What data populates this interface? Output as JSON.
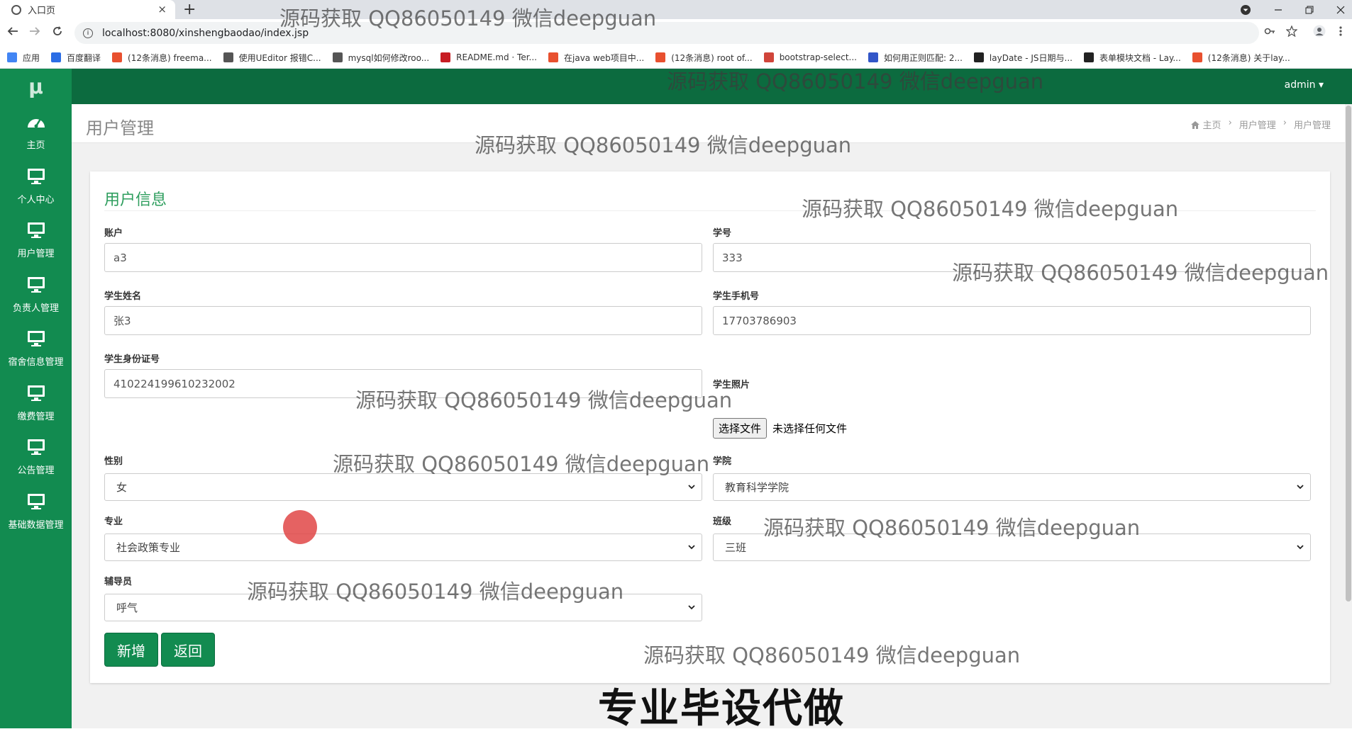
{
  "browser": {
    "tab_title": "入口页",
    "tab_close": "×",
    "new_tab": "+",
    "url": "localhost:8080/xinshengbaodao/index.jsp",
    "bookmarks": [
      {
        "label": "应用",
        "color": "#4285f4"
      },
      {
        "label": "百度翻译",
        "color": "#2b6de5"
      },
      {
        "label": "(12条消息) freema...",
        "color": "#e8502f"
      },
      {
        "label": "使用UEditor 报错C...",
        "color": "#555555"
      },
      {
        "label": "mysql如何修改roo...",
        "color": "#555555"
      },
      {
        "label": "README.md · Ter...",
        "color": "#c71d23"
      },
      {
        "label": "在java web项目中...",
        "color": "#e8502f"
      },
      {
        "label": "(12条消息) root of...",
        "color": "#e8502f"
      },
      {
        "label": "bootstrap-select...",
        "color": "#d0453a"
      },
      {
        "label": "如何用正则匹配: 2...",
        "color": "#3256c8"
      },
      {
        "label": "layDate - JS日期与...",
        "color": "#222222"
      },
      {
        "label": "表单模块文档 - Lay...",
        "color": "#222222"
      },
      {
        "label": "(12条消息) 关于lay...",
        "color": "#e8502f"
      }
    ]
  },
  "app": {
    "logo": "μ",
    "user_menu": "admin ▾",
    "sidebar": [
      {
        "label": "主页",
        "icon": "dashboard-icon"
      },
      {
        "label": "个人中心",
        "icon": "monitor-icon"
      },
      {
        "label": "用户管理",
        "icon": "monitor-icon"
      },
      {
        "label": "负责人管理",
        "icon": "monitor-icon"
      },
      {
        "label": "宿舍信息管理",
        "icon": "monitor-icon"
      },
      {
        "label": "缴费管理",
        "icon": "monitor-icon"
      },
      {
        "label": "公告管理",
        "icon": "monitor-icon"
      },
      {
        "label": "基础数据管理",
        "icon": "monitor-icon"
      }
    ],
    "page_title": "用户管理",
    "breadcrumb": [
      "主页",
      "用户管理",
      "用户管理"
    ],
    "breadcrumb_sep": "›"
  },
  "form": {
    "title": "用户信息",
    "account_label": "账户",
    "account_value": "a3",
    "student_no_label": "学号",
    "student_no_value": "333",
    "name_label": "学生姓名",
    "name_value": "张3",
    "phone_label": "学生手机号",
    "phone_value": "17703786903",
    "idcard_label": "学生身份证号",
    "idcard_value": "410224199610232002",
    "photo_label": "学生照片",
    "file_button": "选择文件",
    "file_status": "未选择任何文件",
    "gender_label": "性别",
    "gender_value": "女",
    "college_label": "学院",
    "college_value": "教育科学学院",
    "major_label": "专业",
    "major_value": "社会政策专业",
    "class_label": "班级",
    "class_value": "三班",
    "counselor_label": "辅导员",
    "counselor_value": "呼气",
    "submit_button": "新增",
    "back_button": "返回"
  },
  "overlay": {
    "watermark": "源码获取 QQ86050149 微信deepguan",
    "banner": "专业毕设代做"
  },
  "colors": {
    "sidebar": "#128b50",
    "topbar": "#0c6b3f",
    "accent": "#2e9e5e"
  }
}
